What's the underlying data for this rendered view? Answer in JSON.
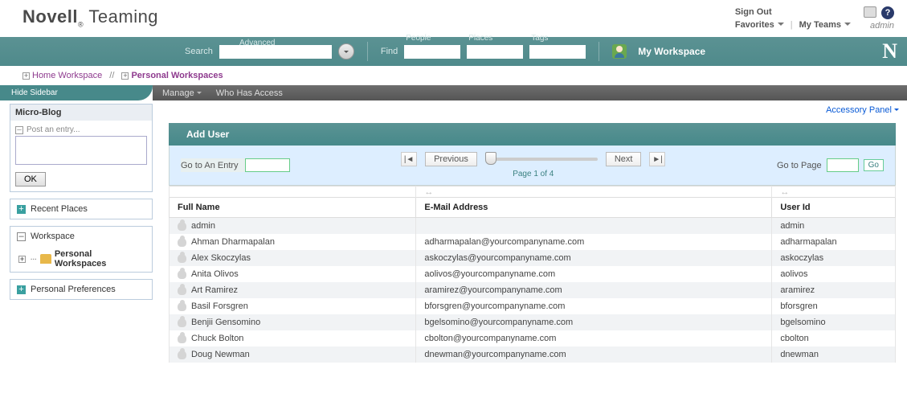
{
  "brand": {
    "novell": "Novell",
    "reg": "®",
    "teaming": "Teaming"
  },
  "header": {
    "signout": "Sign Out",
    "favorites": "Favorites",
    "myteams": "My Teams",
    "admin": "admin"
  },
  "tealbar": {
    "search": "Search",
    "advanced": "Advanced",
    "find": "Find",
    "people": "People",
    "places": "Places",
    "tags": "Tags",
    "myworkspace": "My Workspace",
    "n": "N"
  },
  "breadcrumb": {
    "home": "Home Workspace",
    "sep": "//",
    "personal": "Personal Workspaces"
  },
  "darkbar": {
    "hide": "Hide Sidebar",
    "manage": "Manage",
    "who": "Who Has Access",
    "accessory": "Accessory Panel"
  },
  "sidebar": {
    "microblog": "Micro-Blog",
    "post": "Post an entry...",
    "ok": "OK",
    "recent": "Recent Places",
    "workspace": "Workspace",
    "personal_ws": "Personal Workspaces",
    "prefs": "Personal Preferences"
  },
  "content": {
    "adduser": "Add User",
    "goentry": "Go to An Entry",
    "previous": "Previous",
    "next": "Next",
    "pageof": "Page 1 of 4",
    "gopage": "Go to Page",
    "go": "Go",
    "col_name": "Full Name",
    "col_email": "E-Mail Address",
    "col_uid": "User Id"
  },
  "rows": [
    {
      "name": "admin",
      "email": "",
      "uid": "admin"
    },
    {
      "name": "Ahman Dharmapalan",
      "email": "adharmapalan@yourcompanyname.com",
      "uid": "adharmapalan"
    },
    {
      "name": "Alex Skoczylas",
      "email": "askoczylas@yourcompanyname.com",
      "uid": "askoczylas"
    },
    {
      "name": "Anita Olivos",
      "email": "aolivos@yourcompanyname.com",
      "uid": "aolivos"
    },
    {
      "name": "Art Ramirez",
      "email": "aramirez@yourcompanyname.com",
      "uid": "aramirez"
    },
    {
      "name": "Basil Forsgren",
      "email": "bforsgren@yourcompanyname.com",
      "uid": "bforsgren"
    },
    {
      "name": "Benjii Gensomino",
      "email": "bgelsomino@yourcompanyname.com",
      "uid": "bgelsomino"
    },
    {
      "name": "Chuck Bolton",
      "email": "cbolton@yourcompanyname.com",
      "uid": "cbolton"
    },
    {
      "name": "Doug Newman",
      "email": "dnewman@yourcompanyname.com",
      "uid": "dnewman"
    }
  ]
}
